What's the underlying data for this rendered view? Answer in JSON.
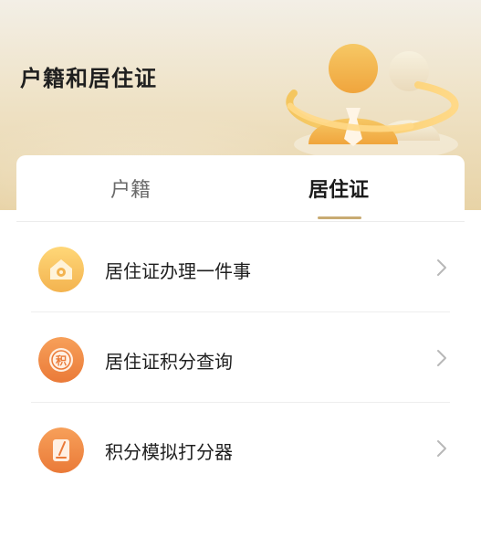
{
  "page": {
    "title": "户籍和居住证"
  },
  "tabs": [
    {
      "label": "户籍",
      "active": false
    },
    {
      "label": "居住证",
      "active": true
    }
  ],
  "list": {
    "items": [
      {
        "label": "居住证办理一件事",
        "icon": "home-icon"
      },
      {
        "label": "居住证积分查询",
        "icon": "points-icon",
        "icon_text": "积"
      },
      {
        "label": "积分模拟打分器",
        "icon": "edit-icon"
      }
    ]
  },
  "colors": {
    "header_gradient_top": "#f3efe6",
    "header_gradient_bottom": "#e8d3a6",
    "accent_gold": "#c8ab72",
    "icon_orange": "#f39a4d",
    "icon_orange_dark": "#e77f38",
    "icon_yellow": "#f4c35d",
    "text_primary": "#1f1f1f",
    "text_secondary": "#6a6a6a"
  }
}
